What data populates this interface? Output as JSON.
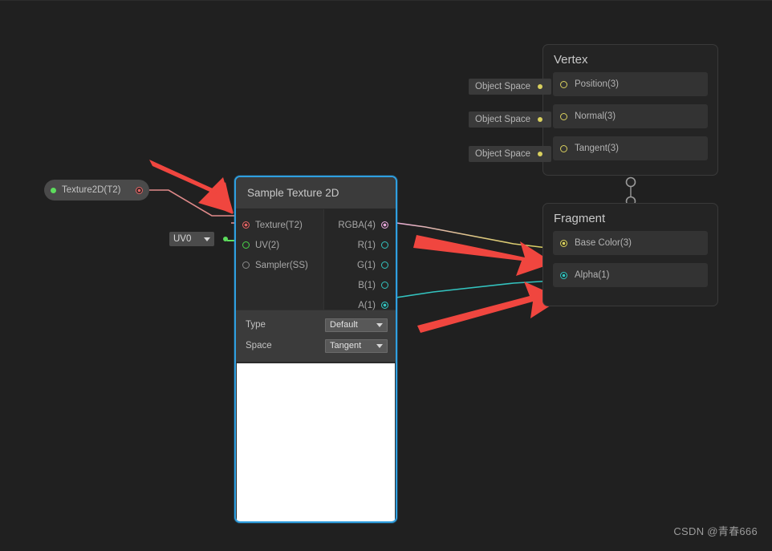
{
  "app": {
    "name": "Unity Shader Graph",
    "canvas_background": "#202020",
    "selection_color": "#2f9fe0",
    "annotation_arrow_color": "#f0463f"
  },
  "watermark": {
    "text": "CSDN @青春666"
  },
  "property_node": {
    "label": "Texture2D(T2)",
    "input_dot_color": "#5ddd5d",
    "output_port_color": "#e06464"
  },
  "uv_node": {
    "value": "UV0",
    "caret": "chevron-down-icon",
    "output_dot_color": "#5ddd5d"
  },
  "sample_texture_node": {
    "title": "Sample Texture 2D",
    "inputs": [
      {
        "label": "Texture(T2)",
        "color": "#e06464",
        "connected": true
      },
      {
        "label": "UV(2)",
        "color": "#49d649",
        "connected": true
      },
      {
        "label": "Sampler(SS)",
        "color": "#8a8a8a",
        "connected": false
      }
    ],
    "outputs": [
      {
        "label": "RGBA(4)",
        "color": "#e5a7d8",
        "connected": true
      },
      {
        "label": "R(1)",
        "color": "#33c3bf",
        "connected": false
      },
      {
        "label": "G(1)",
        "color": "#33c3bf",
        "connected": false
      },
      {
        "label": "B(1)",
        "color": "#33c3bf",
        "connected": false
      },
      {
        "label": "A(1)",
        "color": "#33c3bf",
        "connected": true
      }
    ],
    "controls": [
      {
        "label": "Type",
        "value": "Default"
      },
      {
        "label": "Space",
        "value": "Tangent"
      }
    ],
    "preview": {
      "color": "#ffffff"
    }
  },
  "vertex_node": {
    "title": "Vertex",
    "blocks": [
      {
        "label": "Position(3)",
        "space": "Object Space",
        "port_color": "#d9d05e"
      },
      {
        "label": "Normal(3)",
        "space": "Object Space",
        "port_color": "#d9d05e"
      },
      {
        "label": "Tangent(3)",
        "space": "Object Space",
        "port_color": "#d9d05e"
      }
    ]
  },
  "fragment_node": {
    "title": "Fragment",
    "blocks": [
      {
        "label": "Base Color(3)",
        "port_color": "#d9d05e"
      },
      {
        "label": "Alpha(1)",
        "port_color": "#33c3bf"
      }
    ]
  },
  "connections": [
    {
      "from": "Texture2D(T2)",
      "to": "Texture(T2)",
      "color": "#e08a8a"
    },
    {
      "from": "UV0",
      "to": "UV(2)",
      "color": "#5ddd5d"
    },
    {
      "from": "RGBA(4)",
      "to": "Base Color(3)",
      "color_start": "#e5a7d8",
      "color_end": "#d9d05e"
    },
    {
      "from": "A(1)",
      "to": "Alpha(1)",
      "color": "#33c3bf"
    }
  ]
}
